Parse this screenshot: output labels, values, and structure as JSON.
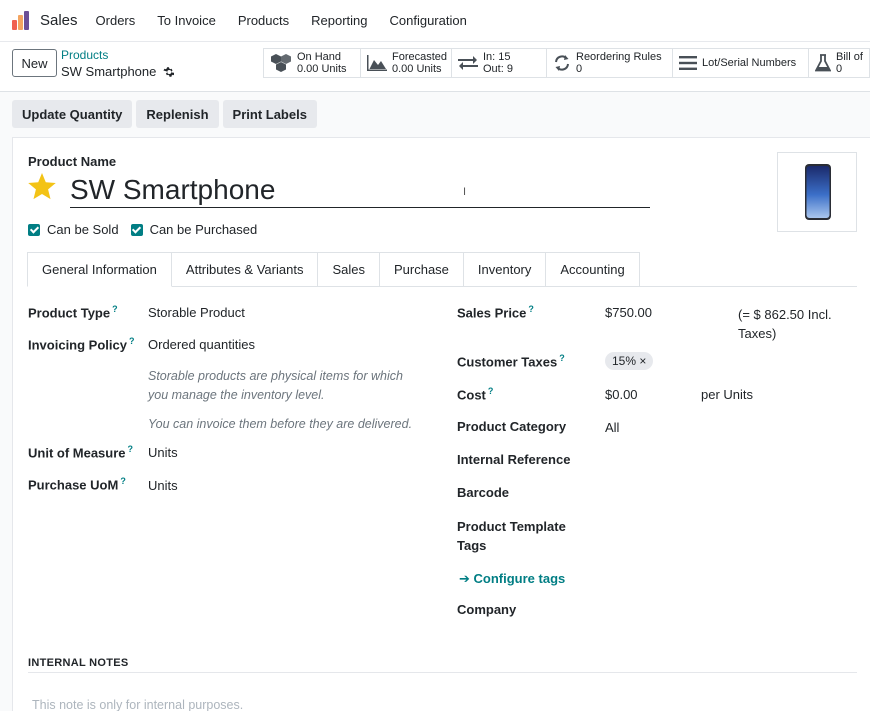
{
  "app": {
    "name": "Sales"
  },
  "colors": {
    "accent": "#017e84",
    "star": "#f3c316"
  },
  "nav": [
    "Orders",
    "To Invoice",
    "Products",
    "Reporting",
    "Configuration"
  ],
  "control_panel": {
    "new_label": "New",
    "breadcrumb_parent": "Products",
    "breadcrumb_current": "SW Smartphone"
  },
  "smart_buttons": {
    "on_hand": {
      "line1": "On Hand",
      "line2": "0.00 Units",
      "icon": "cubes-icon"
    },
    "forecasted": {
      "line1": "Forecasted",
      "line2": "0.00 Units",
      "icon": "area-chart-icon"
    },
    "inout": {
      "line1": "In: 15",
      "line2": "Out: 9",
      "icon": "exchange-icon"
    },
    "reordering": {
      "line1": "Reordering Rules",
      "line2": "0",
      "icon": "refresh-icon"
    },
    "lots": {
      "line1": "Lot/Serial Numbers",
      "icon": "bars-icon"
    },
    "bom": {
      "line1": "Bill of",
      "line2": "0",
      "icon": "flask-icon"
    }
  },
  "actions": [
    "Update Quantity",
    "Replenish",
    "Print Labels"
  ],
  "form": {
    "product_name_label": "Product Name",
    "product_name": "SW Smartphone",
    "can_be_sold": "Can be Sold",
    "can_be_purchased": "Can be Purchased",
    "tabs": [
      "General Information",
      "Attributes & Variants",
      "Sales",
      "Purchase",
      "Inventory",
      "Accounting"
    ],
    "left": {
      "product_type_label": "Product Type",
      "product_type": "Storable Product",
      "invoicing_policy_label": "Invoicing Policy",
      "invoicing_policy": "Ordered quantities",
      "help1_line1": "Storable products are physical items for which",
      "help1_line2": "you manage the inventory level.",
      "help2": "You can invoice them before they are delivered.",
      "uom_label": "Unit of Measure",
      "uom": "Units",
      "purchase_uom_label": "Purchase UoM",
      "purchase_uom": "Units"
    },
    "right": {
      "sales_price_label": "Sales Price",
      "sales_price": "$750.00",
      "incl_taxes_line1": "(= $ 862.50 Incl.",
      "incl_taxes_line2": "Taxes)",
      "customer_taxes_label": "Customer Taxes",
      "tax_tag": "15% ×",
      "cost_label": "Cost",
      "cost": "$0.00",
      "cost_unit": "per Units",
      "category_label": "Product Category",
      "category": "All",
      "internal_ref_label": "Internal Reference",
      "barcode_label": "Barcode",
      "template_tags_line1": "Product Template",
      "template_tags_line2": "Tags",
      "configure_tags": "Configure tags",
      "company_label": "Company"
    },
    "notes_title": "INTERNAL NOTES",
    "notes_placeholder": "This note is only for internal purposes."
  }
}
